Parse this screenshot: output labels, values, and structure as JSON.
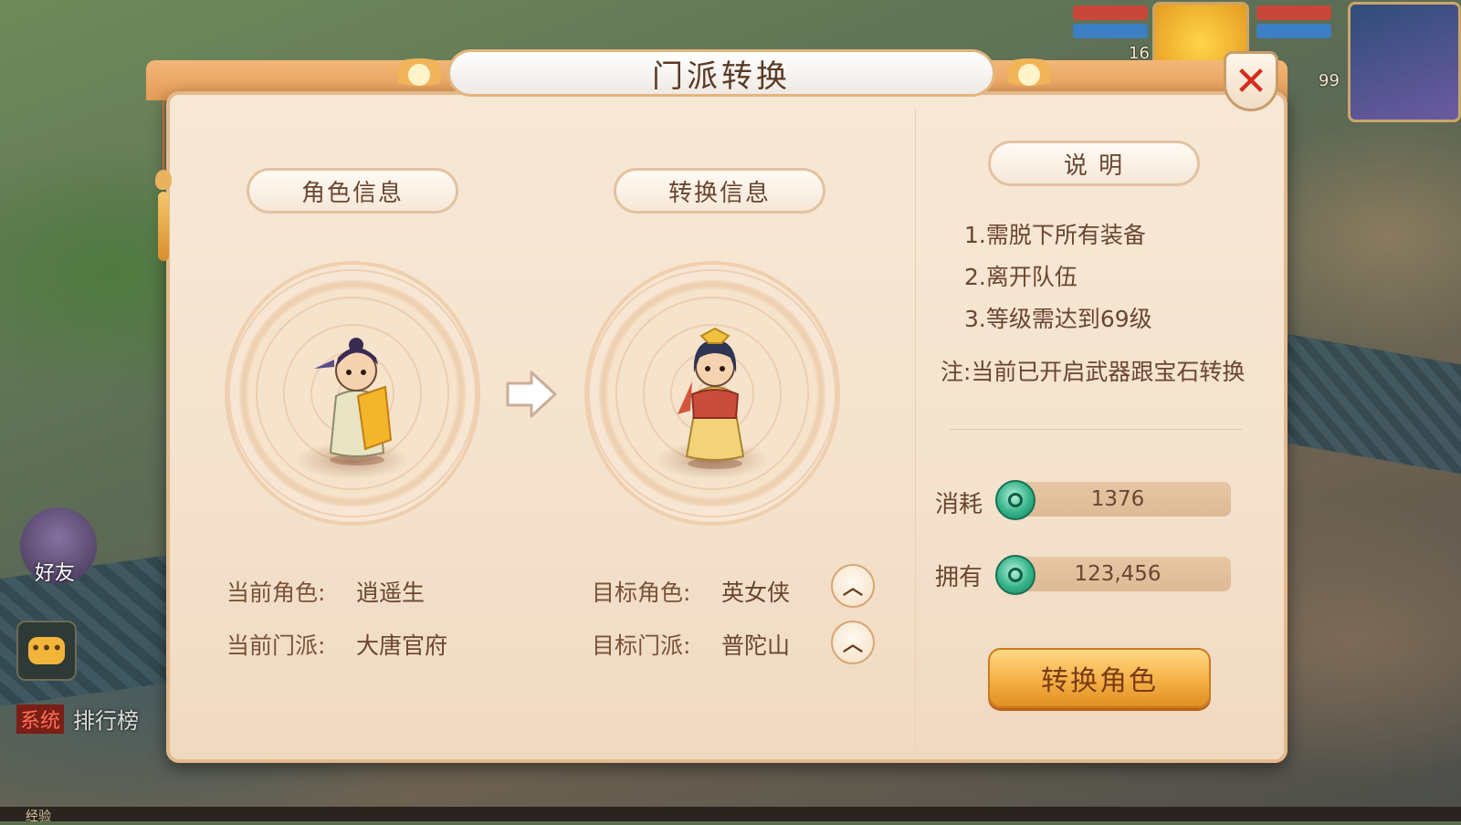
{
  "dialog": {
    "title": "门派转换",
    "close_symbol": "✕"
  },
  "current": {
    "header": "角色信息",
    "role_label": "当前角色:",
    "role_value": "逍遥生",
    "school_label": "当前门派:",
    "school_value": "大唐官府"
  },
  "target": {
    "header": "转换信息",
    "role_label": "目标角色:",
    "role_value": "英女侠",
    "school_label": "目标门派:",
    "school_value": "普陀山"
  },
  "explanation": {
    "header": "说 明",
    "rules": [
      "1.需脱下所有装备",
      "2.离开队伍",
      "3.等级需达到69级"
    ],
    "note": "注:当前已开启武器跟宝石转换"
  },
  "cost": {
    "consume_label": "消耗",
    "consume_value": "1376",
    "own_label": "拥有",
    "own_value": "123,456"
  },
  "action_button": "转换角色",
  "hud": {
    "friend_label": "好友",
    "chat_glyph": "•••",
    "system_tag": "系统",
    "rank_text": "排行榜",
    "level_a": "16",
    "level_b": "99",
    "exp_label": "经验"
  },
  "colors": {
    "accent": "#e49a57",
    "panel": "#f4e2cd",
    "close_red": "#d62b1f",
    "coin_green": "#34b38a",
    "button_orange": "#f4b046"
  }
}
